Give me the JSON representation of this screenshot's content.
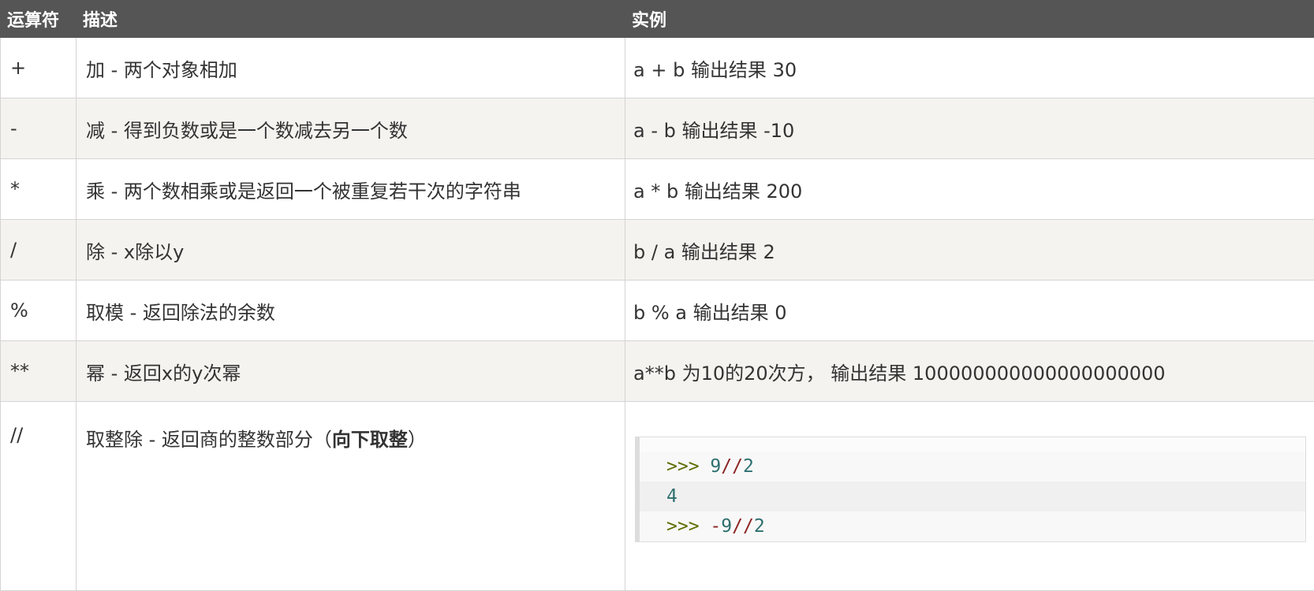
{
  "header": {
    "col_operator": "运算符",
    "col_description": "描述",
    "col_example": "实例"
  },
  "rows": [
    {
      "op": "+",
      "desc": "加 - 两个对象相加",
      "example": "a + b 输出结果 30"
    },
    {
      "op": "-",
      "desc": "减 - 得到负数或是一个数减去另一个数",
      "example": "a - b 输出结果 -10"
    },
    {
      "op": "*",
      "desc": "乘 - 两个数相乘或是返回一个被重复若干次的字符串",
      "example": "a * b 输出结果 200"
    },
    {
      "op": "/",
      "desc": "除 - x除以y",
      "example": "b / a 输出结果 2"
    },
    {
      "op": "%",
      "desc": "取模 - 返回除法的余数",
      "example": "b % a 输出结果 0"
    },
    {
      "op": "**",
      "desc": "幂 - 返回x的y次幂",
      "example": "a**b 为10的20次方， 输出结果 100000000000000000000"
    },
    {
      "op": "//",
      "desc_prefix": "取整除 - 返回商的整数部分（",
      "desc_bold": "向下取整",
      "desc_suffix": "）",
      "code": {
        "line1": {
          "prompt": ">>>",
          "num": "9",
          "op": "//",
          "num2": "2"
        },
        "line2": {
          "output": "4"
        },
        "line3": {
          "prompt": ">>>",
          "minus": "-",
          "num": "9",
          "op": "//",
          "num2": "2"
        }
      }
    }
  ]
}
